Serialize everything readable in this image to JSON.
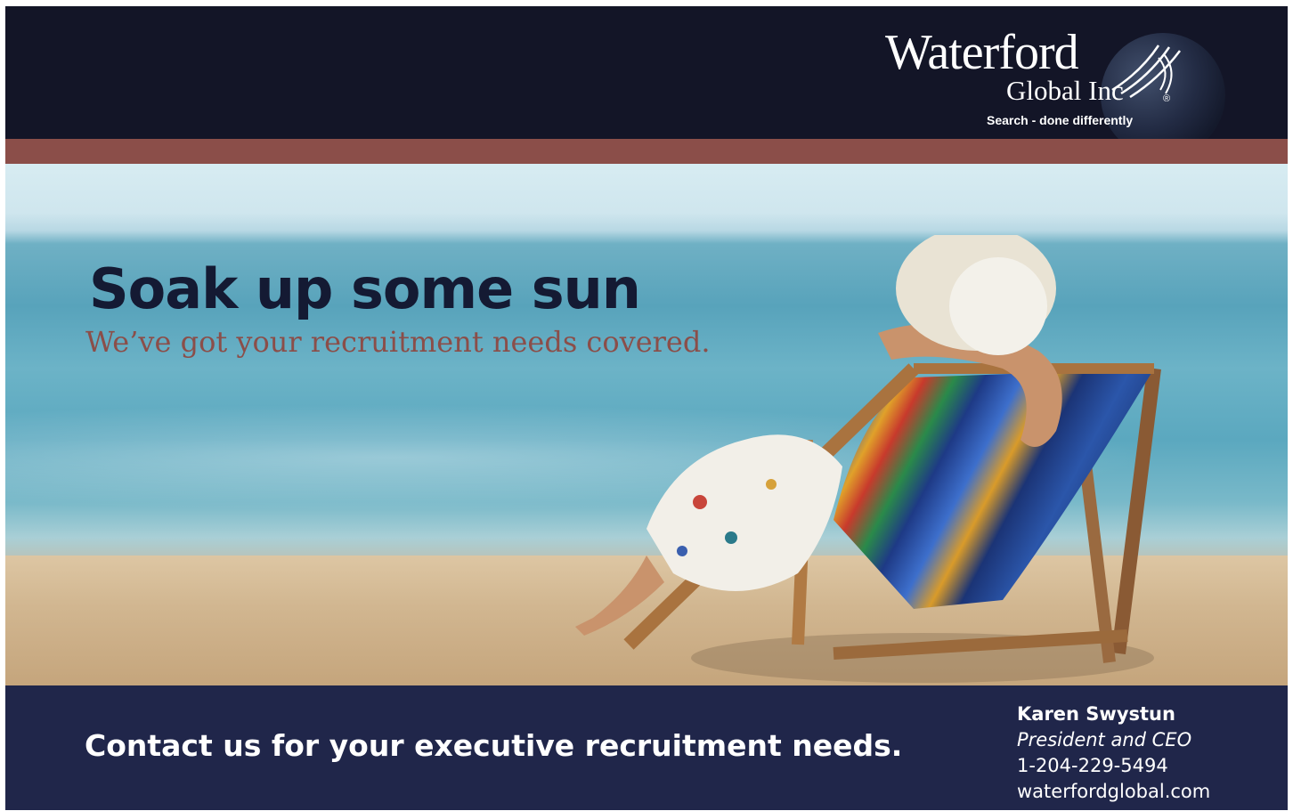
{
  "brand": {
    "wordmark": "Waterford",
    "sub": "Global Inc",
    "registered": "®",
    "tagline": "Search - done differently"
  },
  "hero": {
    "headline": "Soak up some sun",
    "subheadline": "We’ve got your recruitment needs covered."
  },
  "footer": {
    "cta": "Contact us for your executive recruitment needs.",
    "contact": {
      "name": "Karen Swystun",
      "title": "President and CEO",
      "phone": "1-204-229-5494",
      "website": "waterfordglobal.com"
    }
  },
  "colors": {
    "header_bg": "#131527",
    "accent_stripe": "#8b4e49",
    "footer_bg": "#20264a",
    "headline": "#141a33",
    "subheadline": "#8b4e49"
  },
  "icons": [
    "globe-icon"
  ]
}
